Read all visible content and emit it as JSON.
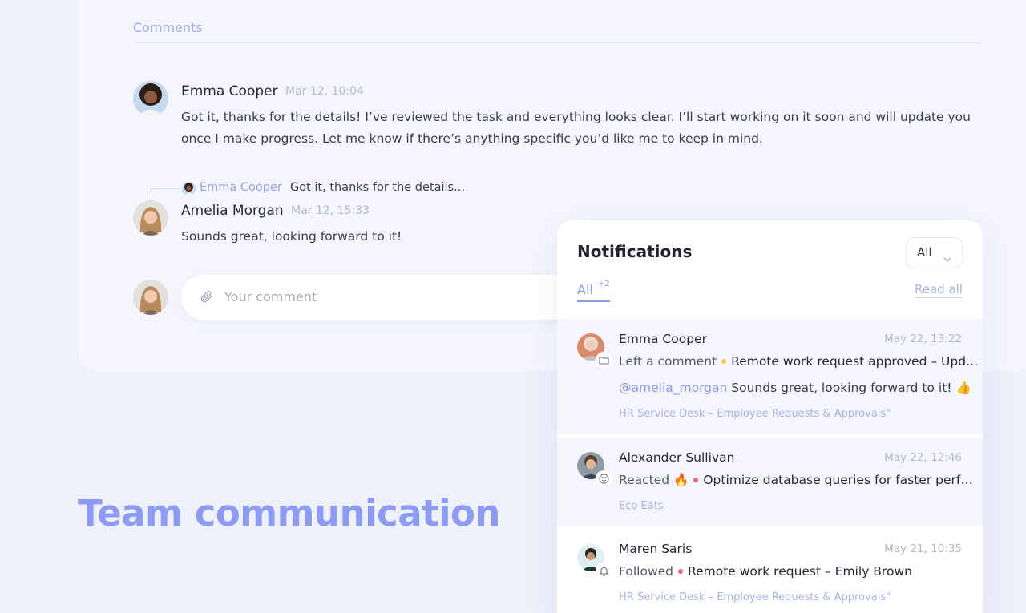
{
  "comments": {
    "heading": "Comments",
    "items": [
      {
        "author": "Emma Cooper",
        "time": "Mar 12, 10:04",
        "text_line1": "Got it, thanks for the details! I’ve reviewed the task and everything looks clear. I’ll start working on it soon and will update you",
        "text_line2": "once I make progress. Let me know if there’s anything specific you’d like me to keep in mind."
      },
      {
        "reply_to_author": "Emma Cooper",
        "reply_to_snippet": "Got it, thanks for the details...",
        "author": "Amelia Morgan",
        "time": "Mar 12, 15:33",
        "text": "Sounds great, looking forward to it!"
      }
    ],
    "input_placeholder": "Your comment"
  },
  "headline": "Team communication",
  "notifications": {
    "title": "Notifications",
    "filter_value": "All",
    "tab_all_label": "All",
    "tab_all_count": "+2",
    "read_all_label": "Read all",
    "items": [
      {
        "name": "Emma Cooper",
        "date": "May 22, 13:22",
        "action": "Left a comment",
        "dot_color": "#f5c451",
        "task": "Remote work request approved – Upd…",
        "mention": "@amelia_morgan",
        "message": "Sounds great, looking forward to it! 👍",
        "project": "HR Service Desk – Employee Requests & Approvals\"",
        "badge_icon": "folder-icon"
      },
      {
        "name": "Alexander Sullivan",
        "date": "May 22, 12:46",
        "action": "Reacted",
        "emoji": "🔥",
        "dot_color": "#ef5f7a",
        "task": "Optimize database queries for faster perf…",
        "project": "Eco Eats",
        "badge_icon": "smiley-icon"
      },
      {
        "name": "Maren Saris",
        "date": "May 21, 10:35",
        "action": "Followed",
        "dot_color": "#ef5f7a",
        "task": "Remote work request – Emily Brown",
        "project": "HR Service Desk – Employee Requests & Approvals\"",
        "badge_icon": "bell-icon"
      }
    ]
  },
  "colors": {
    "accent": "#8b99ee",
    "headline": "#8d9cf2",
    "background": "#eef0fb"
  }
}
